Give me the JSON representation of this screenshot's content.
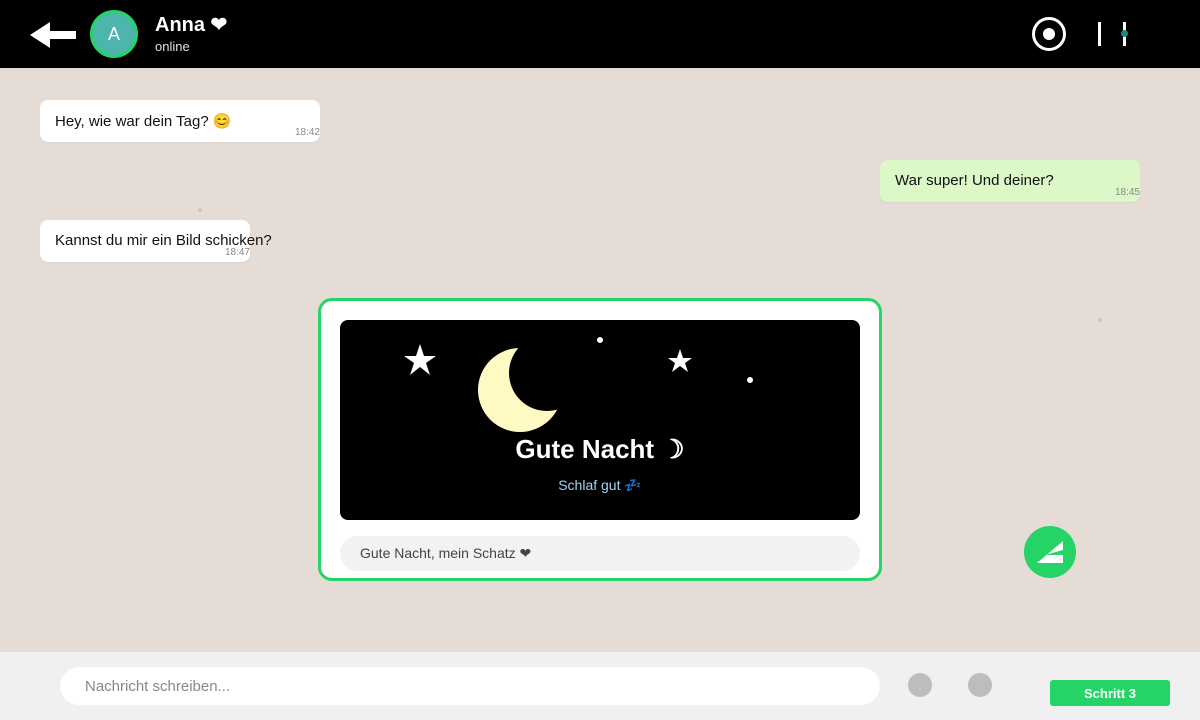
{
  "header": {
    "back_icon": "arrow-left-icon",
    "avatar_initial": "A",
    "contact_name": "Anna ❤",
    "status": "online",
    "record_icon": "record-icon",
    "menu_icon": "slider-menu-icon"
  },
  "messages": [
    {
      "direction": "in",
      "text": "Hey, wie war dein Tag? 😊",
      "time": "18:42"
    },
    {
      "direction": "out",
      "text": "War super! Und deiner?",
      "time": "18:45"
    },
    {
      "direction": "in",
      "text": "Kannst du mir ein Bild schicken?",
      "time": "18:47"
    }
  ],
  "image_card": {
    "title": "Gute Nacht ☽",
    "subtitle": "Schlaf gut 💤",
    "caption": "Gute Nacht, mein Schatz ❤"
  },
  "send_icon": "send-icon",
  "composer": {
    "placeholder": "Nachricht schreiben...",
    "icon_a": "attachment-icon",
    "icon_b": "camera-icon",
    "step_label": "Schritt 3"
  },
  "colors": {
    "accent": "#25d366",
    "chat_background": "#e5ddd5",
    "outgoing_bubble": "#dcf8c6",
    "topbar": "#000000"
  }
}
